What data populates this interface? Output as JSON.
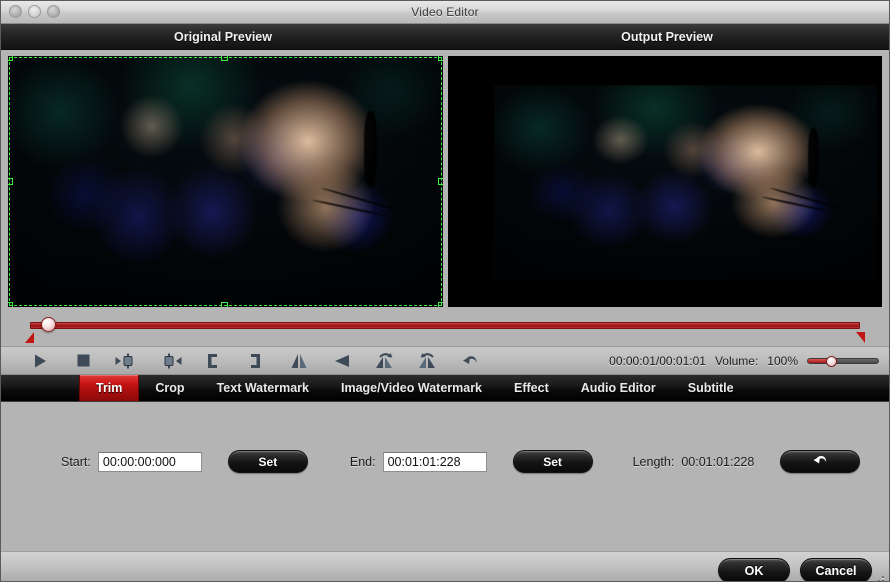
{
  "window": {
    "title": "Video Editor",
    "traffic_lights": [
      "close",
      "minimize",
      "zoom"
    ]
  },
  "previews": {
    "original_label": "Original Preview",
    "output_label": "Output Preview"
  },
  "timeline": {
    "position_ratio": 0.015,
    "start_marker": "start",
    "end_marker": "end"
  },
  "controls": {
    "buttons": [
      {
        "name": "play",
        "label": "Play"
      },
      {
        "name": "stop",
        "label": "Stop"
      },
      {
        "name": "previous-frame",
        "label": "Previous Frame"
      },
      {
        "name": "next-frame",
        "label": "Next Frame"
      },
      {
        "name": "set-start-point",
        "label": "Set Start Point"
      },
      {
        "name": "set-end-point",
        "label": "Set End Point"
      },
      {
        "name": "flip-vertical",
        "label": "Flip Vertical"
      },
      {
        "name": "flip-horizontal",
        "label": "Flip Horizontal"
      },
      {
        "name": "rotate-left",
        "label": "Rotate Left"
      },
      {
        "name": "rotate-right",
        "label": "Rotate Right"
      },
      {
        "name": "reset",
        "label": "Reset"
      }
    ],
    "timecode": "00:00:01/00:01:01",
    "volume_label": "Volume:",
    "volume_value": "100%",
    "volume_ratio": 0.27
  },
  "tabs": [
    {
      "label": "Trim",
      "active": true
    },
    {
      "label": "Crop",
      "active": false
    },
    {
      "label": "Text Watermark",
      "active": false
    },
    {
      "label": "Image/Video Watermark",
      "active": false
    },
    {
      "label": "Effect",
      "active": false
    },
    {
      "label": "Audio Editor",
      "active": false
    },
    {
      "label": "Subtitle",
      "active": false
    }
  ],
  "trim": {
    "start_label": "Start:",
    "start_value": "00:00:00:000",
    "start_set_label": "Set",
    "end_label": "End:",
    "end_value": "00:01:01:228",
    "end_set_label": "Set",
    "length_label": "Length:",
    "length_value": "00:01:01:228",
    "reset_icon": "undo-arrow-icon"
  },
  "footer": {
    "ok_label": "OK",
    "cancel_label": "Cancel"
  },
  "colors": {
    "accent_red": "#c61414",
    "crop_green": "#3cf03c",
    "chrome_gray": "#b4b4b4"
  }
}
